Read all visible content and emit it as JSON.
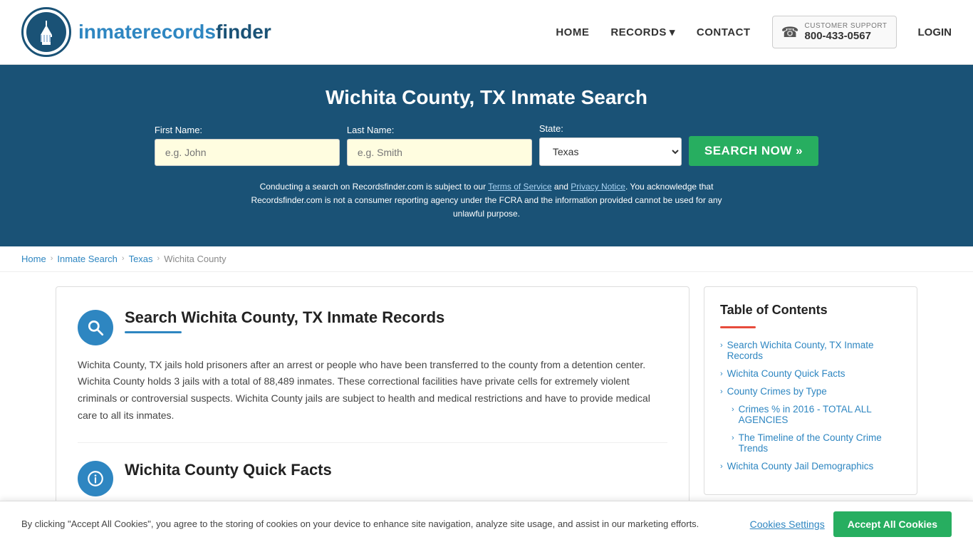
{
  "header": {
    "logo_text_normal": "inmaterecords",
    "logo_text_bold": "finder",
    "nav": {
      "home": "HOME",
      "records": "RECORDS",
      "contact": "CONTACT",
      "login": "LOGIN"
    },
    "support": {
      "label": "CUSTOMER SUPPORT",
      "number": "800-433-0567"
    }
  },
  "hero": {
    "title": "Wichita County, TX Inmate Search",
    "form": {
      "first_name_label": "First Name:",
      "first_name_placeholder": "e.g. John",
      "last_name_label": "Last Name:",
      "last_name_placeholder": "e.g. Smith",
      "state_label": "State:",
      "state_value": "Texas",
      "search_btn": "SEARCH NOW »"
    },
    "disclaimer": "Conducting a search on Recordsfinder.com is subject to our Terms of Service and Privacy Notice. You acknowledge that Recordsfinder.com is not a consumer reporting agency under the FCRA and the information provided cannot be used for any unlawful purpose."
  },
  "breadcrumb": {
    "items": [
      "Home",
      "Inmate Search",
      "Texas",
      "Wichita County"
    ]
  },
  "main": {
    "section1": {
      "title": "Search Wichita County, TX Inmate Records",
      "body": "Wichita County, TX jails hold prisoners after an arrest or people who have been transferred to the county from a detention center. Wichita County holds 3 jails with a total of 88,489 inmates. These correctional facilities have private cells for extremely violent criminals or controversial suspects. Wichita County jails are subject to health and medical restrictions and have to provide medical care to all its inmates."
    },
    "section2": {
      "title": "Wichita County Quick Facts"
    }
  },
  "toc": {
    "title": "Table of Contents",
    "items": [
      {
        "label": "Search Wichita County, TX Inmate Records",
        "sub": false
      },
      {
        "label": "Wichita County Quick Facts",
        "sub": false
      },
      {
        "label": "County Crimes by Type",
        "sub": false
      },
      {
        "label": "Crimes % in 2016 - TOTAL ALL AGENCIES",
        "sub": true
      },
      {
        "label": "The Timeline of the County Crime Trends",
        "sub": true
      },
      {
        "label": "Wichita County Jail Demographics",
        "sub": false
      }
    ]
  },
  "cookie_banner": {
    "text": "By clicking \"Accept All Cookies\", you agree to the storing of cookies on your device to enhance site navigation, analyze site usage, and assist in our marketing efforts.",
    "settings_btn": "Cookies Settings",
    "accept_btn": "Accept All Cookies"
  }
}
